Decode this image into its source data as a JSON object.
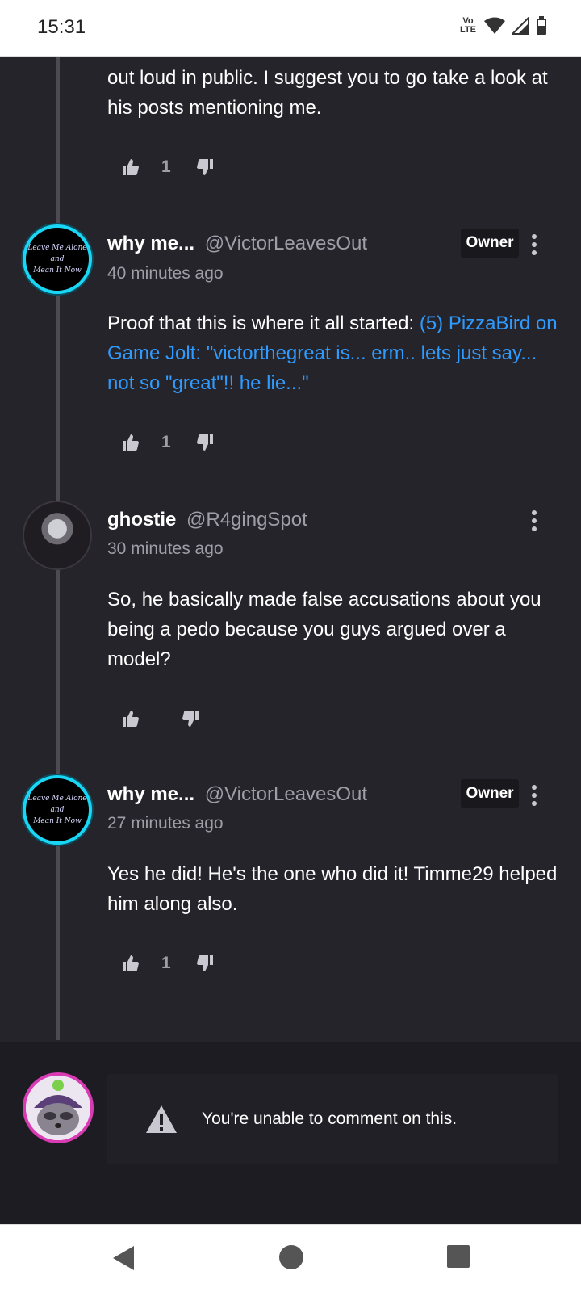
{
  "status_bar": {
    "time": "15:31",
    "network_label": "Vo LTE"
  },
  "comments": [
    {
      "text": "out loud in public. I suggest you to go take a look at his posts mentioning me.",
      "likes": "1"
    },
    {
      "author_name": "why me...",
      "author_handle": "@VictorLeavesOut",
      "badge": "Owner",
      "time_ago": "40 minutes ago",
      "text_prefix": "Proof that this is where it all started: ",
      "link_text": "(5) PizzaBird on Game Jolt: \"victorthegreat is... erm.. lets just say... not so \"great\"!! he lie...\"",
      "likes": "1",
      "avatar_text": [
        "Leave Me Alone",
        "and",
        "Mean It Now"
      ]
    },
    {
      "author_name": "ghostie",
      "author_handle": "@R4gingSpot",
      "time_ago": "30 minutes ago",
      "text": "So, he basically made false accusations about you being a pedo because you guys argued over a model?",
      "likes": ""
    },
    {
      "author_name": "why me...",
      "author_handle": "@VictorLeavesOut",
      "badge": "Owner",
      "time_ago": "27 minutes ago",
      "text": "Yes he did! He's the one who did it! Timme29 helped him along also.",
      "likes": "1",
      "avatar_text": [
        "Leave Me Alone",
        "and",
        "Mean It Now"
      ]
    }
  ],
  "composer": {
    "notice": "You're unable to comment on this."
  },
  "icons": {
    "like": "thumbs-up-icon",
    "dislike": "thumbs-down-icon",
    "more": "more-vert-icon",
    "warning": "warning-icon",
    "back": "back-triangle-icon",
    "home": "home-circle-icon",
    "recents": "recents-square-icon"
  },
  "colors": {
    "background": "#25242b",
    "link": "#2f9bff",
    "owner_ring": "#19d6f4"
  }
}
